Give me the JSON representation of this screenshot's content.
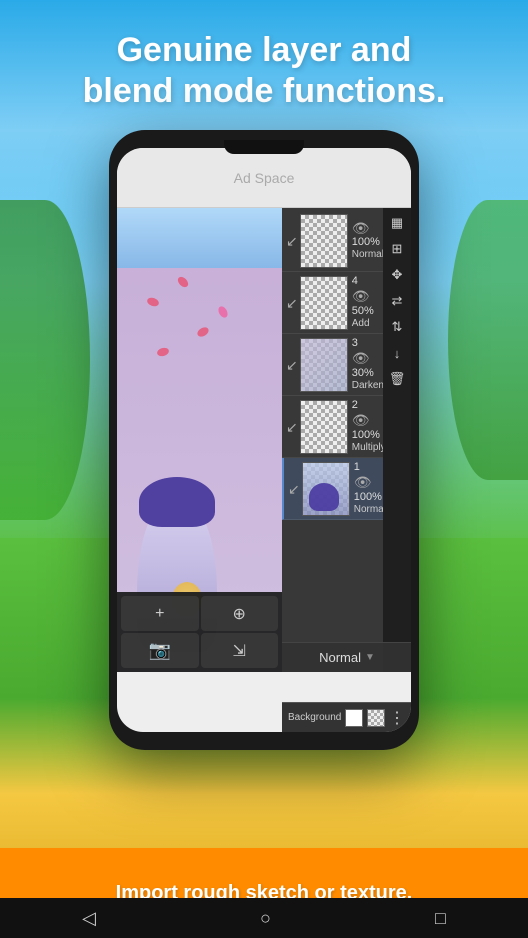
{
  "background": {
    "sky_color_top": "#2aaae8",
    "sky_color_mid": "#7ecef5",
    "field_color": "#5abf3e"
  },
  "headline": {
    "line1_prefix": "Genuine ",
    "line1_bold": "layer",
    "line1_suffix": " and",
    "line2_bold": "blend mode",
    "line2_suffix": " functions."
  },
  "ad_space": {
    "label": "Ad Space"
  },
  "layers": {
    "items": [
      {
        "num": "",
        "opacity": "100%",
        "blend": "Normal",
        "has_content": false
      },
      {
        "num": "4",
        "opacity": "50%",
        "blend": "Add",
        "has_content": false
      },
      {
        "num": "3",
        "opacity": "30%",
        "blend": "Darken",
        "has_content": true
      },
      {
        "num": "2",
        "opacity": "100%",
        "blend": "Multiply",
        "has_content": false
      },
      {
        "num": "1",
        "opacity": "100%",
        "blend": "Normal",
        "has_content": true,
        "selected": true
      }
    ],
    "background_label": "Background"
  },
  "normal_blend": {
    "label": "Normal"
  },
  "bottom_banner": {
    "text": "Import rough sketch or texture."
  },
  "nav": {
    "back": "◁",
    "home": "○",
    "menu": "□"
  },
  "toolbar_icons": {
    "add": "+",
    "merge": "⊞",
    "copy": "⧉",
    "export": "↓",
    "camera": "📷"
  }
}
